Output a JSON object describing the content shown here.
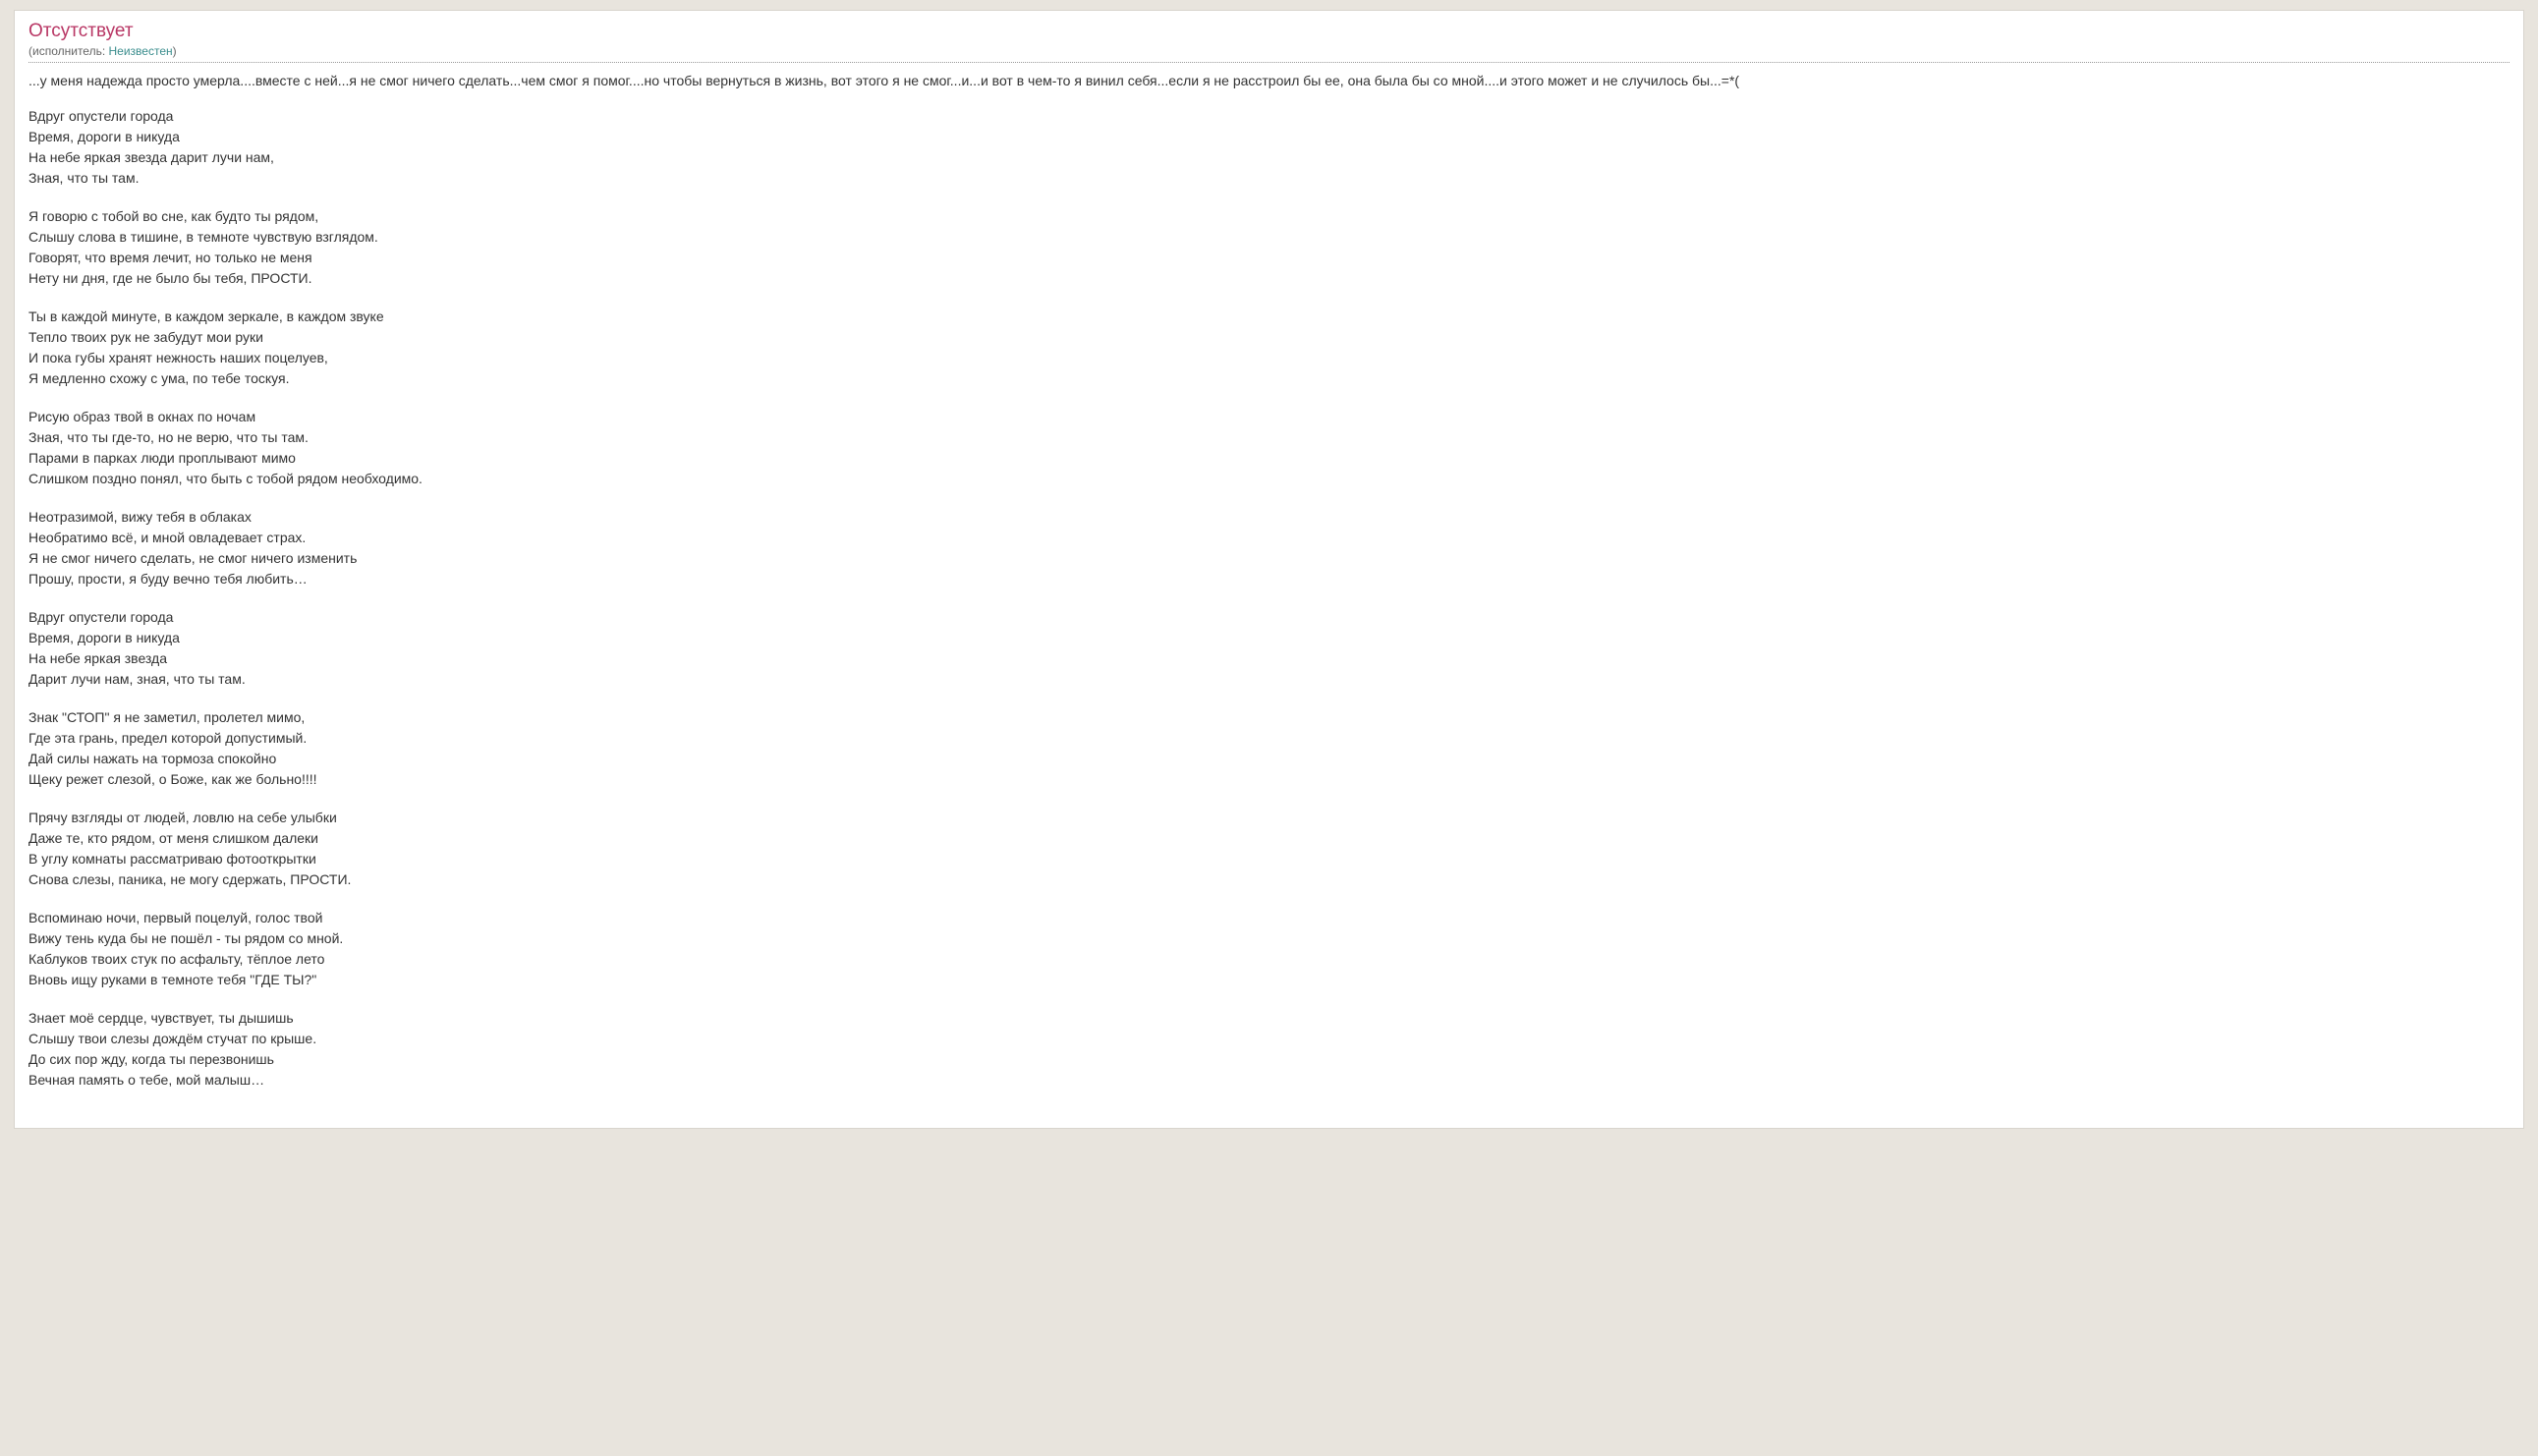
{
  "header": {
    "title": "Отсутствует",
    "performer_label_prefix": "(исполнитель: ",
    "performer_name": "Неизвестен",
    "performer_label_suffix": ")"
  },
  "intro": "...у меня надежда просто умерла....вместе с ней...я не смог ничего сделать...чем смог я помог....но чтобы вернуться в жизнь, вот этого я не смог...и...и вот в чем-то я винил себя...если  я не расстроил бы ее, она была бы со мной....и этого может и не случилось бы...=*(",
  "stanzas": [
    "Вдруг опустели города\nВремя, дороги в никуда\nНа небе яркая звезда дарит лучи нам,\nЗная, что ты там.",
    "Я говорю с тобой во сне, как будто ты рядом,\nСлышу слова в тишине, в темноте чувствую взглядом.\nГоворят, что время лечит, но только не меня\nНету ни дня, где не было бы тебя, ПРОСТИ.",
    "Ты в каждой минуте, в каждом зеркале, в каждом звуке\nТепло твоих рук не забудут мои руки\nИ пока губы хранят нежность наших поцелуев,\nЯ медленно схожу с ума, по тебе тоскуя.",
    "Рисую образ твой в окнах по ночам\nЗная, что ты где-то, но не верю, что ты там.\nПарами в парках люди проплывают мимо\nСлишком поздно понял, что быть с тобой рядом необходимо.",
    "Неотразимой, вижу тебя в облаках\nНеобратимо всё, и мной овладевает страх.\nЯ не смог ничего сделать, не смог ничего изменить\nПрошу, прости, я буду вечно тебя любить…",
    "Вдруг опустели города\nВремя, дороги в никуда\nНа небе яркая звезда\nДарит лучи нам, зная, что ты там.",
    "Знак \"СТОП\" я не заметил, пролетел мимо,\nГде эта грань, предел которой допустимый.\nДай силы нажать на тормоза спокойно\nЩеку режет слезой, о Боже, как же больно!!!!",
    "Прячу взгляды от людей, ловлю на себе улыбки\nДаже те, кто рядом, от меня слишком далеки\nВ углу комнаты рассматриваю фотооткрытки\nСнова слезы, паника, не могу сдержать, ПРОСТИ.",
    "Вспоминаю ночи, первый поцелуй, голос твой\nВижу тень куда бы не пошёл - ты рядом со мной.\nКаблуков твоих стук по асфальту, тёплое лето\nВновь ищу руками в темноте тебя \"ГДЕ ТЫ?\"",
    "Знает моё сердце, чувствует, ты дышишь\nСлышу твои слезы дождём стучат по крыше.\nДо сих пор жду, когда ты перезвонишь\nВечная память о тебе, мой малыш…"
  ]
}
